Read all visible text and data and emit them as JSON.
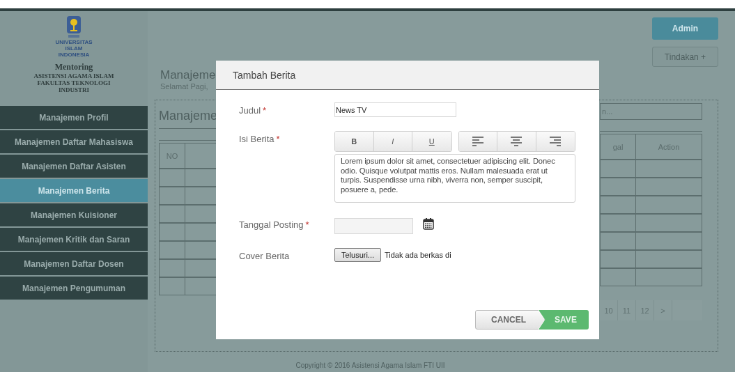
{
  "brand": {
    "logo_lines": [
      "UNIVERSITAS",
      "ISLAM",
      "INDONESIA"
    ],
    "app_name": "Mentoring",
    "org_lines": [
      "ASISTENSI AGAMA ISLAM",
      "FAKULTAS TEKNOLOGI",
      "INDUSTRI"
    ]
  },
  "sidebar": {
    "items": [
      {
        "label": "Manajemen Profil",
        "selected": false
      },
      {
        "label": "Manajemen Daftar Mahasiswa",
        "selected": false
      },
      {
        "label": "Manajemen Daftar Asisten",
        "selected": false
      },
      {
        "label": "Manajemen Berita",
        "selected": true
      },
      {
        "label": "Manajemen Kuisioner",
        "selected": false
      },
      {
        "label": "Manajemen Kritik dan Saran",
        "selected": false
      },
      {
        "label": "Manajemen Daftar Dosen",
        "selected": false
      },
      {
        "label": "Manajemen Pengumuman",
        "selected": false
      }
    ]
  },
  "page": {
    "title": "Manajeme",
    "greeting": "Selamat Pagi,",
    "user_button": "Admin",
    "actions_button": "Tindakan +"
  },
  "panel": {
    "title": "Manajeme",
    "search": {
      "placeholder": "n..."
    },
    "table": {
      "columns_left": [
        "NO"
      ],
      "columns_right": [
        "gal",
        "Action"
      ]
    },
    "pagination": [
      "10",
      "11",
      "12",
      ">"
    ]
  },
  "modal": {
    "title": "Tambah Berita",
    "fields": [
      {
        "kind": "text",
        "label": "Judul",
        "required_mark": "*",
        "value": "News TV"
      },
      {
        "kind": "editor",
        "label": "Isi Berita",
        "required_mark": "*",
        "format_buttons": [
          "B",
          "I",
          "U"
        ],
        "value": "Lorem ipsum dolor sit amet, consectetuer adipiscing elit. Donec odio. Quisque volutpat mattis eros. Nullam malesuada erat ut turpis. Suspendisse urna nibh, viverra non, semper suscipit, posuere a, pede."
      },
      {
        "kind": "date",
        "label": "Tanggal Posting",
        "required_mark": "*"
      },
      {
        "kind": "file",
        "label": "Cover Berita",
        "button": "Telusuri...",
        "status": "Tidak ada berkas di"
      }
    ],
    "cancel": "CANCEL",
    "save": "SAVE"
  },
  "footer": "Copyright © 2016 Asistensi Agama Islam FTI UII"
}
